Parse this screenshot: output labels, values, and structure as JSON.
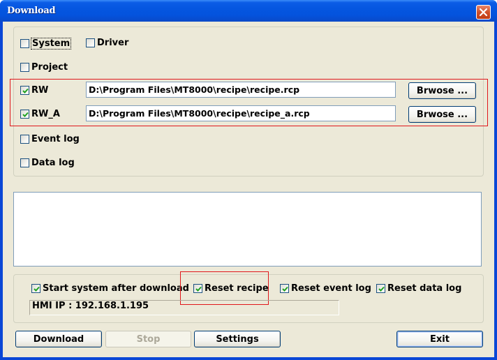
{
  "window": {
    "title": "Download",
    "close_icon": "close-x-icon"
  },
  "download_items": {
    "system": {
      "label": "System",
      "checked": false
    },
    "driver": {
      "label": "Driver",
      "checked": false
    },
    "project": {
      "label": "Project",
      "checked": false
    },
    "rw": {
      "label": "RW",
      "checked": true,
      "path": "D:\\Program Files\\MT8000\\recipe\\recipe.rcp",
      "browse_label": "Brwose ..."
    },
    "rw_a": {
      "label": "RW_A",
      "checked": true,
      "path": "D:\\Program Files\\MT8000\\recipe\\recipe_a.rcp",
      "browse_label": "Brwose ..."
    },
    "event_log": {
      "label": "Event log",
      "checked": false
    },
    "data_log": {
      "label": "Data log",
      "checked": false
    }
  },
  "log_area": {
    "content": ""
  },
  "options": {
    "start_system": {
      "label": "Start system after download",
      "checked": true
    },
    "reset_recipe": {
      "label": "Reset recipe",
      "checked": true
    },
    "reset_event_log": {
      "label": "Reset event log",
      "checked": true
    },
    "reset_data_log": {
      "label": "Reset data log",
      "checked": true
    },
    "hmi_ip": "HMI IP : 192.168.1.195"
  },
  "buttons": {
    "download": "Download",
    "stop": "Stop",
    "settings": "Settings",
    "exit": "Exit"
  },
  "colors": {
    "titlebar": "#0556e0",
    "dialog_bg": "#ece9d8",
    "highlight": "#e0161a",
    "check_mark": "#21a121"
  }
}
